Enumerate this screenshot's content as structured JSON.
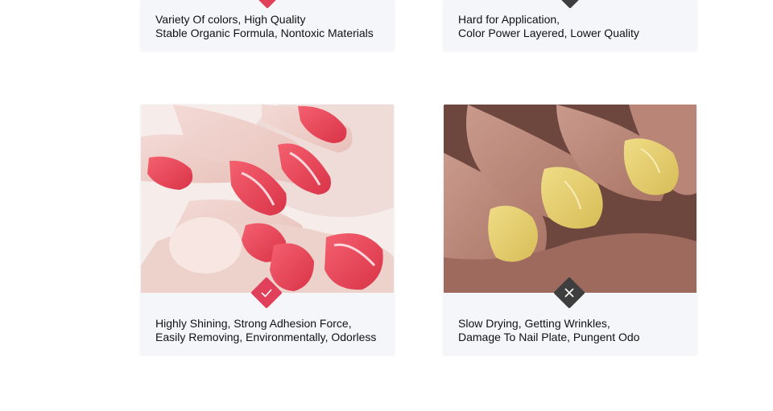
{
  "comparison": {
    "top_row": {
      "good_caption": [
        "Variety Of colors, High Quality",
        "Stable Organic Formula, Nontoxic Materials"
      ],
      "bad_caption": [
        "Hard for Application,",
        "Color Power Layered, Lower Quality"
      ]
    },
    "bottom_row": {
      "good_caption": [
        "Highly Shining, Strong Adhesion Force,",
        "Easily Removing, Environmentally, Odorless"
      ],
      "bad_caption": [
        "Slow Drying, Getting Wrinkles,",
        "Damage To Nail Plate, Pungent Odo"
      ]
    }
  },
  "icons": {
    "good": "check-icon",
    "bad": "cross-icon"
  },
  "colors": {
    "good_badge": "#e0405a",
    "bad_badge": "#3e3e3e",
    "card_background": "#f5f6fa",
    "red_polish": "#ee4a5c",
    "yellow_polish": "#e7d06e"
  }
}
